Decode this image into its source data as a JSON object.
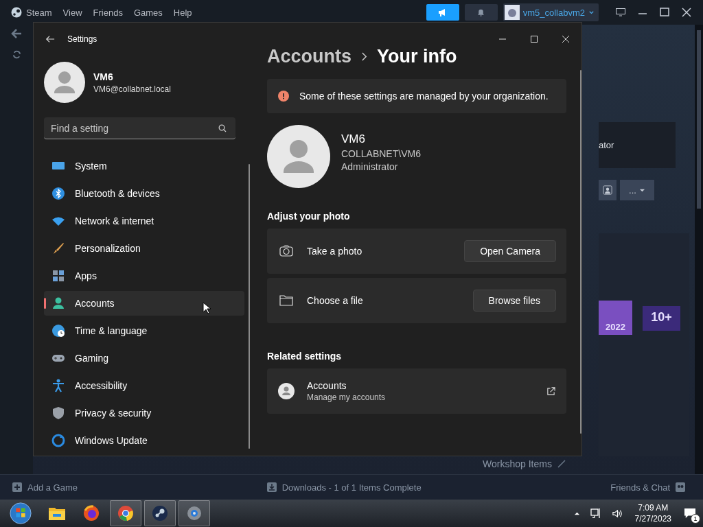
{
  "steam": {
    "menu": [
      "Steam",
      "View",
      "Friends",
      "Games",
      "Help"
    ],
    "username": "vm5_collabvm2",
    "profile_fragment": "ator",
    "more_button": "...",
    "badges": [
      {
        "label": "2022",
        "color": "#7a4fc0"
      },
      {
        "label": "10+",
        "color": "#3b2a7a"
      }
    ],
    "workshop": "Workshop Items",
    "bottom_bar": {
      "add_game": "Add a Game",
      "downloads": "Downloads - 1 of 1 Items Complete",
      "friends": "Friends & Chat"
    }
  },
  "settings": {
    "title": "Settings",
    "user": {
      "name": "VM6",
      "email": "VM6@collabnet.local"
    },
    "search": {
      "placeholder": "Find a setting"
    },
    "nav": [
      {
        "label": "System",
        "selected": false
      },
      {
        "label": "Bluetooth & devices",
        "selected": false
      },
      {
        "label": "Network & internet",
        "selected": false
      },
      {
        "label": "Personalization",
        "selected": false
      },
      {
        "label": "Apps",
        "selected": false
      },
      {
        "label": "Accounts",
        "selected": true
      },
      {
        "label": "Time & language",
        "selected": false
      },
      {
        "label": "Gaming",
        "selected": false
      },
      {
        "label": "Accessibility",
        "selected": false
      },
      {
        "label": "Privacy & security",
        "selected": false
      },
      {
        "label": "Windows Update",
        "selected": false
      }
    ],
    "breadcrumb": {
      "parent": "Accounts",
      "current": "Your info"
    },
    "banner": "Some of these settings are managed by your organization.",
    "profile": {
      "name": "VM6",
      "account": "COLLABNET\\VM6",
      "role": "Administrator"
    },
    "photo_section": {
      "title": "Adjust your photo",
      "rows": [
        {
          "label": "Take a photo",
          "button": "Open Camera"
        },
        {
          "label": "Choose a file",
          "button": "Browse files"
        }
      ]
    },
    "related": {
      "title": "Related settings",
      "items": [
        {
          "title": "Accounts",
          "subtitle": "Manage my accounts"
        }
      ]
    }
  },
  "taskbar": {
    "apps": [
      {
        "active": false
      },
      {
        "active": false
      },
      {
        "active": false
      },
      {
        "active": true
      },
      {
        "active": true
      },
      {
        "active": true
      }
    ],
    "time": "7:09 AM",
    "date": "7/27/2023",
    "notifications": "1"
  }
}
